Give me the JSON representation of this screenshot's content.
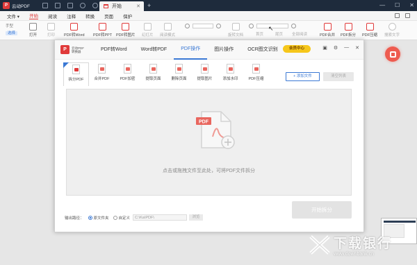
{
  "titlebar": {
    "logo_glyph": "P",
    "app_name": "云动PDF",
    "tab_label": "开始",
    "add_tab": "+",
    "min": "—",
    "max": "☐",
    "close": "✕"
  },
  "menubar": {
    "items": [
      "文件 ▾",
      "开始",
      "阅读",
      "注释",
      "转换",
      "页面",
      "保护"
    ],
    "active_index": 1
  },
  "ribbon": {
    "select_tools": [
      "手型",
      "选择"
    ],
    "buttons": [
      {
        "label": "打开",
        "dim": false
      },
      {
        "label": "打印",
        "dim": true
      },
      {
        "label": "PDF转Word",
        "dim": false
      },
      {
        "label": "PDF转PPT",
        "dim": false
      },
      {
        "label": "PDF转图片",
        "dim": false
      },
      {
        "label": "幻灯片",
        "dim": true
      },
      {
        "label": "阅读模式",
        "dim": true
      },
      {
        "label": "旋转文档",
        "dim": true
      },
      {
        "label": "首页",
        "dim": true
      },
      {
        "label": "尾页",
        "dim": true
      },
      {
        "label": "全部阅读",
        "dim": true
      },
      {
        "label": "PDF合并",
        "dim": false
      },
      {
        "label": "PDF拆分",
        "dim": false
      },
      {
        "label": "PDF压缩",
        "dim": false
      },
      {
        "label": "搜索文字",
        "dim": true
      }
    ]
  },
  "dialog": {
    "logo_mark": "P",
    "logo_text_1": "云动PDF",
    "logo_text_2": "转换器",
    "tabs": [
      "PDF转Word",
      "Word转PDF",
      "PDF操作",
      "图片操作",
      "OCR图文识别"
    ],
    "active_tab": 2,
    "vip_label": "会员中心",
    "tools": [
      "拆分PDF",
      "合并PDF",
      "PDF加密",
      "提取页面",
      "删除页面",
      "提取图片",
      "添加水印",
      "PDF压缩"
    ],
    "active_tool": 0,
    "add_file_label": "+ 添加文件",
    "clear_label": "清空列表",
    "drop_hint": "点击或拖拽文件至此处，可将PDF文件拆分",
    "start_label": "开始拆分",
    "output_label": "输出路径：",
    "option_original": "原文件夹",
    "option_custom": "自定义",
    "path_value": "C:\\Ka\\PDF\\",
    "browse_label": "浏览"
  },
  "watermark": {
    "title": "下载银行",
    "url": "www.downbank.cn"
  },
  "colors": {
    "accent": "#3a78d4",
    "brand_red": "#e03a3a",
    "titlebar": "#1e2b3c",
    "vip": "#f6c71b"
  }
}
